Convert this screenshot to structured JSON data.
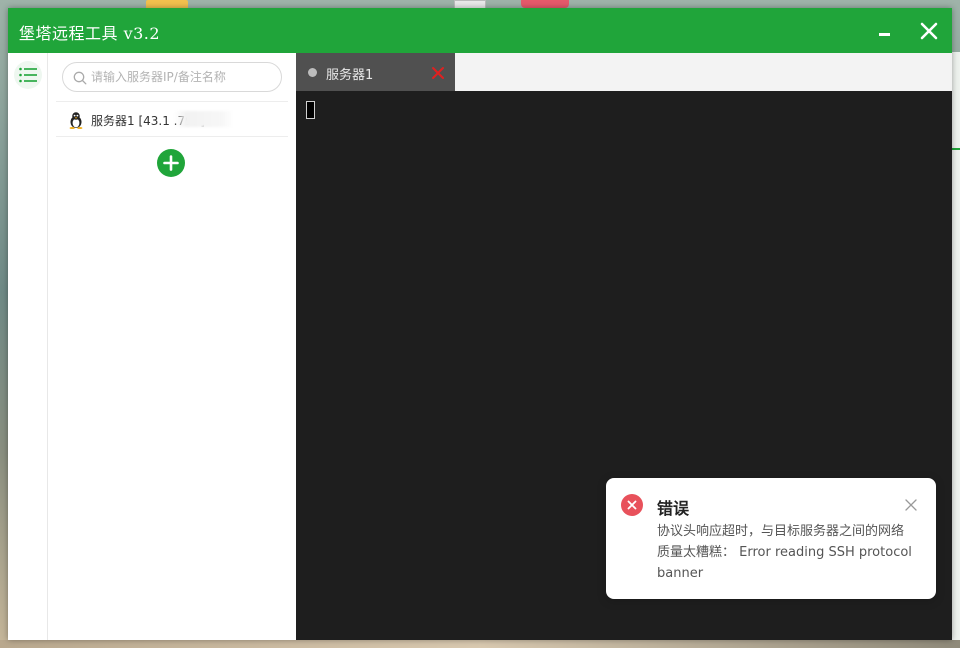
{
  "window": {
    "title": "堡塔远程工具 v3.2"
  },
  "sidebar": {
    "search_placeholder": "请输入服务器IP/备注名称",
    "servers": [
      {
        "label": "服务器1 [43.1  .79.  ]",
        "os": "linux"
      }
    ]
  },
  "tabs": [
    {
      "label": "服务器1",
      "active": true
    }
  ],
  "toast": {
    "title": "错误",
    "message": "协议头响应超时，与目标服务器之间的网络质量太糟糕：  Error reading SSH protocol banner"
  },
  "colors": {
    "brand": "#20a53a",
    "terminal_bg": "#1e1e1e",
    "tab_bg": "#505050",
    "error": "#e8515b",
    "tab_close": "#e02020"
  }
}
